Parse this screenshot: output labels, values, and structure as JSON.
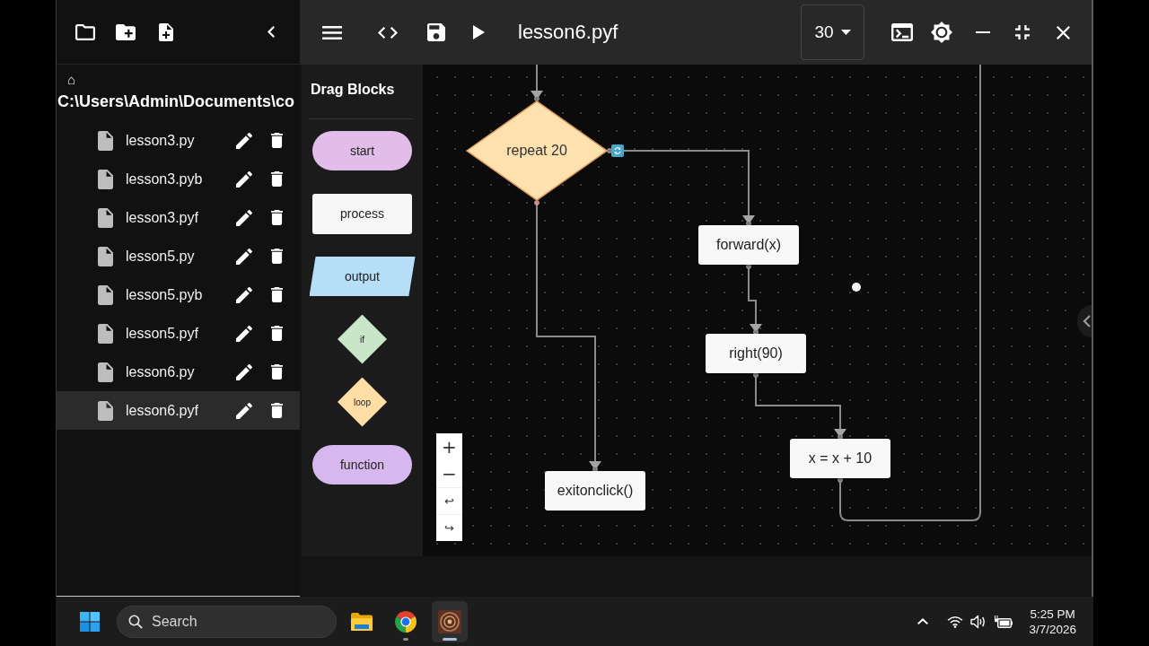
{
  "sidebar": {
    "home_glyph": "⌂",
    "path": "C:\\Users\\Admin\\Documents\\co",
    "files": [
      {
        "name": "lesson3.py",
        "selected": false
      },
      {
        "name": "lesson3.pyb",
        "selected": false
      },
      {
        "name": "lesson3.pyf",
        "selected": false
      },
      {
        "name": "lesson5.py",
        "selected": false
      },
      {
        "name": "lesson5.pyb",
        "selected": false
      },
      {
        "name": "lesson5.pyf",
        "selected": false
      },
      {
        "name": "lesson6.py",
        "selected": false
      },
      {
        "name": "lesson6.pyf",
        "selected": true
      }
    ]
  },
  "toolbar": {
    "file_title": "lesson6.pyf",
    "speed": {
      "value": "30"
    }
  },
  "palette": {
    "title": "Drag Blocks",
    "blocks": [
      {
        "label": "start",
        "kind": "start"
      },
      {
        "label": "process",
        "kind": "process"
      },
      {
        "label": "output",
        "kind": "output"
      },
      {
        "label": "if",
        "kind": "if"
      },
      {
        "label": "loop",
        "kind": "loop"
      },
      {
        "label": "function",
        "kind": "function"
      }
    ]
  },
  "canvas": {
    "nodes": [
      {
        "label": "repeat 20",
        "kind": "loop"
      },
      {
        "label": "forward(x)",
        "kind": "process"
      },
      {
        "label": "right(90)",
        "kind": "process"
      },
      {
        "label": "x = x + 10",
        "kind": "process"
      },
      {
        "label": "exitonclick()",
        "kind": "process"
      }
    ],
    "zoom_controls": [
      "+",
      "−",
      "↩",
      "↪"
    ]
  },
  "taskbar": {
    "search": {
      "placeholder": "Search"
    },
    "apps": [
      {
        "kind": "folder",
        "running": false,
        "selected": false
      },
      {
        "kind": "browser",
        "running": true,
        "selected": false
      },
      {
        "kind": "app",
        "running": true,
        "selected": true
      }
    ],
    "time": "5:25 PM",
    "date": "3/7/2026"
  }
}
